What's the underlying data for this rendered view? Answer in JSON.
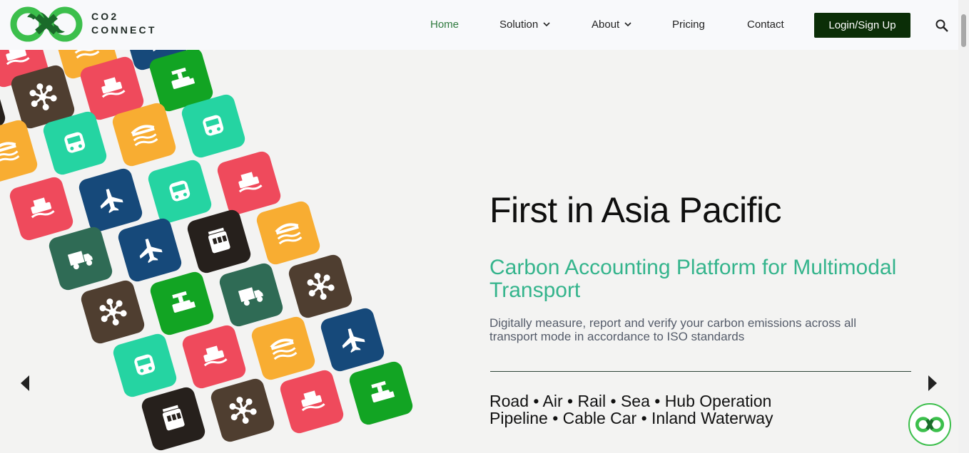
{
  "brand": {
    "line1": "CO2",
    "line2": "CONNECT",
    "logo_icon": "infinity-logo-icon",
    "colors": {
      "dark_green": "#1a6b2a",
      "light_green": "#3cbf4c"
    }
  },
  "nav": {
    "items": [
      {
        "label": "Home",
        "active": true,
        "dropdown": false
      },
      {
        "label": "Solution",
        "active": false,
        "dropdown": true
      },
      {
        "label": "About",
        "active": false,
        "dropdown": true
      },
      {
        "label": "Pricing",
        "active": false,
        "dropdown": false
      },
      {
        "label": "Contact",
        "active": false,
        "dropdown": false
      }
    ],
    "login_label": "Login/Sign Up",
    "search_icon": "search-icon"
  },
  "hero": {
    "title": "First in Asia Pacific",
    "subtitle": "Carbon Accounting Platform for Multimodal Transport",
    "description": "Digitally measure, report and verify your carbon emissions across all transport mode in accordance to ISO standards",
    "modes_line1": "Road • Air • Rail • Sea • Hub Operation",
    "modes_line2": "Pipeline • Cable Car • Inland Waterway",
    "prev_icon": "arrow-left-icon",
    "next_icon": "arrow-right-icon",
    "colors": {
      "accent": "#34b48c",
      "title": "#0f0f0f",
      "login_bg": "#0b2e07"
    }
  },
  "tiles": {
    "icons": [
      "ship-icon",
      "airplane-icon",
      "train-icon",
      "truck-icon",
      "hub-network-icon",
      "pipeline-icon",
      "cable-car-icon",
      "waterway-icon"
    ],
    "colors": {
      "ship": "#ef4a5c",
      "waterway": "#f8ad32",
      "airplane": "#16497a",
      "hub": "#4f3e30",
      "pipeline": "#12a423",
      "train": "#25d4a2",
      "truck": "#2f6b55",
      "cablecar": "#26201c"
    }
  },
  "chat_badge_icon": "chat-logo-icon"
}
